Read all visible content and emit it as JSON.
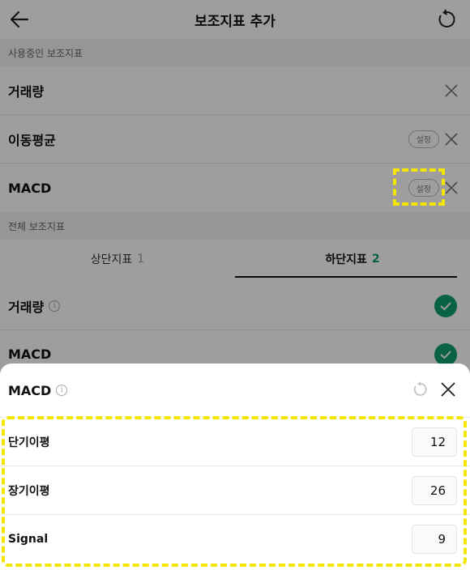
{
  "header": {
    "title": "보조지표 추가"
  },
  "active_section": {
    "title": "사용중인 보조지표",
    "items": [
      {
        "label": "거래량"
      },
      {
        "label": "이동평균",
        "setting": "설정"
      },
      {
        "label": "MACD",
        "setting": "설정"
      }
    ]
  },
  "all_section": {
    "title": "전체 보조지표",
    "tabs": [
      {
        "label": "상단지표",
        "count": "1"
      },
      {
        "label": "하단지표",
        "count": "2"
      }
    ],
    "items": [
      {
        "label": "거래량"
      },
      {
        "label": "MACD"
      }
    ]
  },
  "sheet": {
    "title": "MACD",
    "params": [
      {
        "label": "단기이평",
        "value": "12"
      },
      {
        "label": "장기이평",
        "value": "26"
      },
      {
        "label": "Signal",
        "value": "9"
      }
    ]
  },
  "colors": {
    "accent": "#109e6c",
    "highlight": "#f3e600",
    "dim": "rgba(0,0,0,0.38)"
  }
}
